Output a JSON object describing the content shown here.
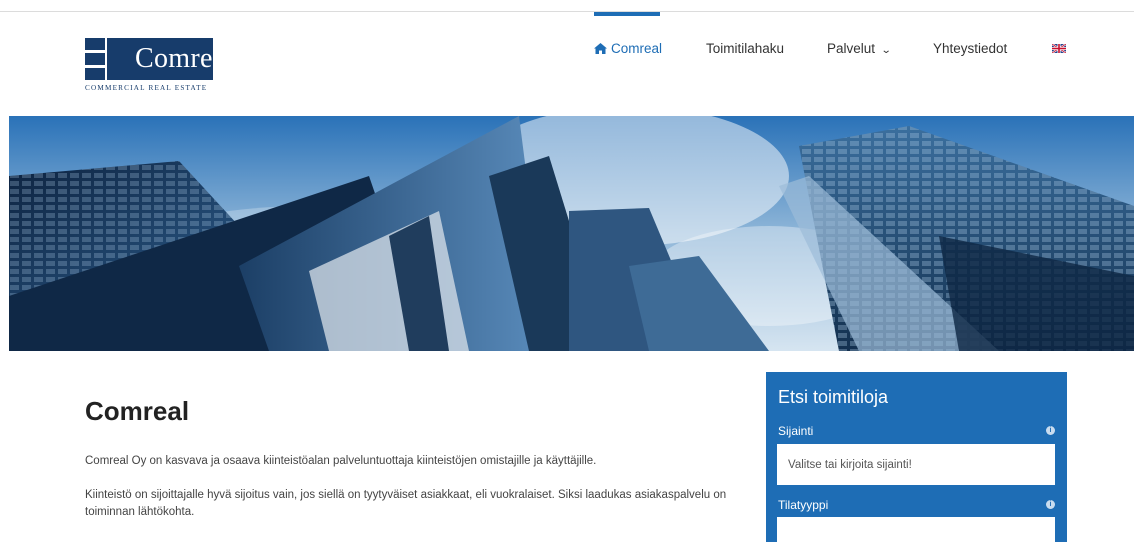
{
  "brand": {
    "name": "Comreal",
    "tagline": "COMMERCIAL REAL ESTATE"
  },
  "nav": {
    "items": [
      {
        "label": "Comreal",
        "icon": "home-icon",
        "active": true
      },
      {
        "label": "Toimitilahaku"
      },
      {
        "label": "Palvelut",
        "icon": "chevron-down-icon"
      },
      {
        "label": "Yhteystiedot"
      }
    ],
    "language_icon": "uk-flag-icon"
  },
  "main": {
    "heading": "Comreal",
    "paragraphs": [
      "Comreal Oy on kasvava ja osaava kiinteistöalan palveluntuottaja kiinteistöjen omistajille ja käyttäjille.",
      "Kiinteistö on sijoittajalle hyvä sijoitus vain, jos siellä on tyytyväiset asiakkaat, eli vuokralaiset. Siksi laadukas asiakaspalvelu on toiminnan lähtökohta."
    ]
  },
  "search_panel": {
    "title": "Etsi toimitiloja",
    "fields": [
      {
        "label": "Sijainti",
        "placeholder": "Valitse tai kirjoita sijainti!"
      },
      {
        "label": "Tilatyyppi",
        "placeholder": ""
      }
    ]
  },
  "colors": {
    "accent": "#1e6db5",
    "brand": "#173c6b"
  }
}
